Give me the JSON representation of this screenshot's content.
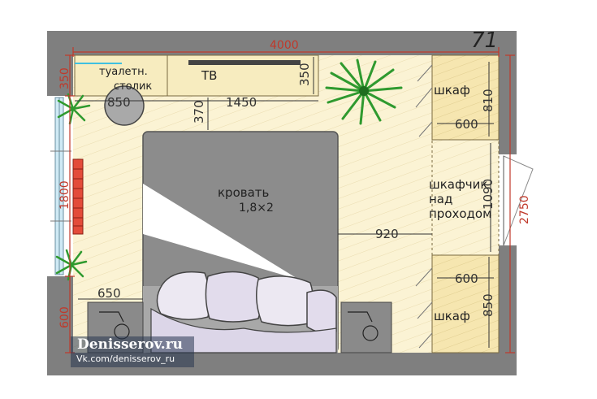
{
  "sheet_number": "71",
  "rooms": {
    "vanity_table": [
      "туалетн.",
      "столик"
    ],
    "tv": "ТВ",
    "bed": [
      "кровать",
      "1,8×2"
    ],
    "wardrobe_top": "шкаф",
    "wardrobe_bottom": "шкаф",
    "cabinet_over_passage": [
      "шкафчик",
      "над",
      "проходом"
    ]
  },
  "dimensions": {
    "room_width": "4000",
    "room_depth": "2750",
    "top_left_red": "350",
    "window": "1800",
    "bottom_left_red": "600",
    "tv_depth": "350",
    "table_width": "850",
    "tv_width": "1450",
    "gap_to_bed": "370",
    "bed_to_wardrobe": "920",
    "nightstand": "650",
    "wardrobe_top_width": "600",
    "wardrobe_top_depth": "810",
    "cabinet_length": "1090",
    "wardrobe_bottom_width": "600",
    "wardrobe_bottom_depth": "850"
  },
  "watermark": {
    "title": "Denisserov.ru",
    "subtitle": "Vk.com/denisserov_ru"
  },
  "colors": {
    "wall": "#7f7f7f",
    "floor": "#fbf3d4",
    "floor_stripe": "#eadcb0",
    "bed": "#8c8c8c",
    "dimension_red": "#c0392b",
    "plant": "#2f9a2f",
    "window_glass": "#cfeaf5"
  }
}
